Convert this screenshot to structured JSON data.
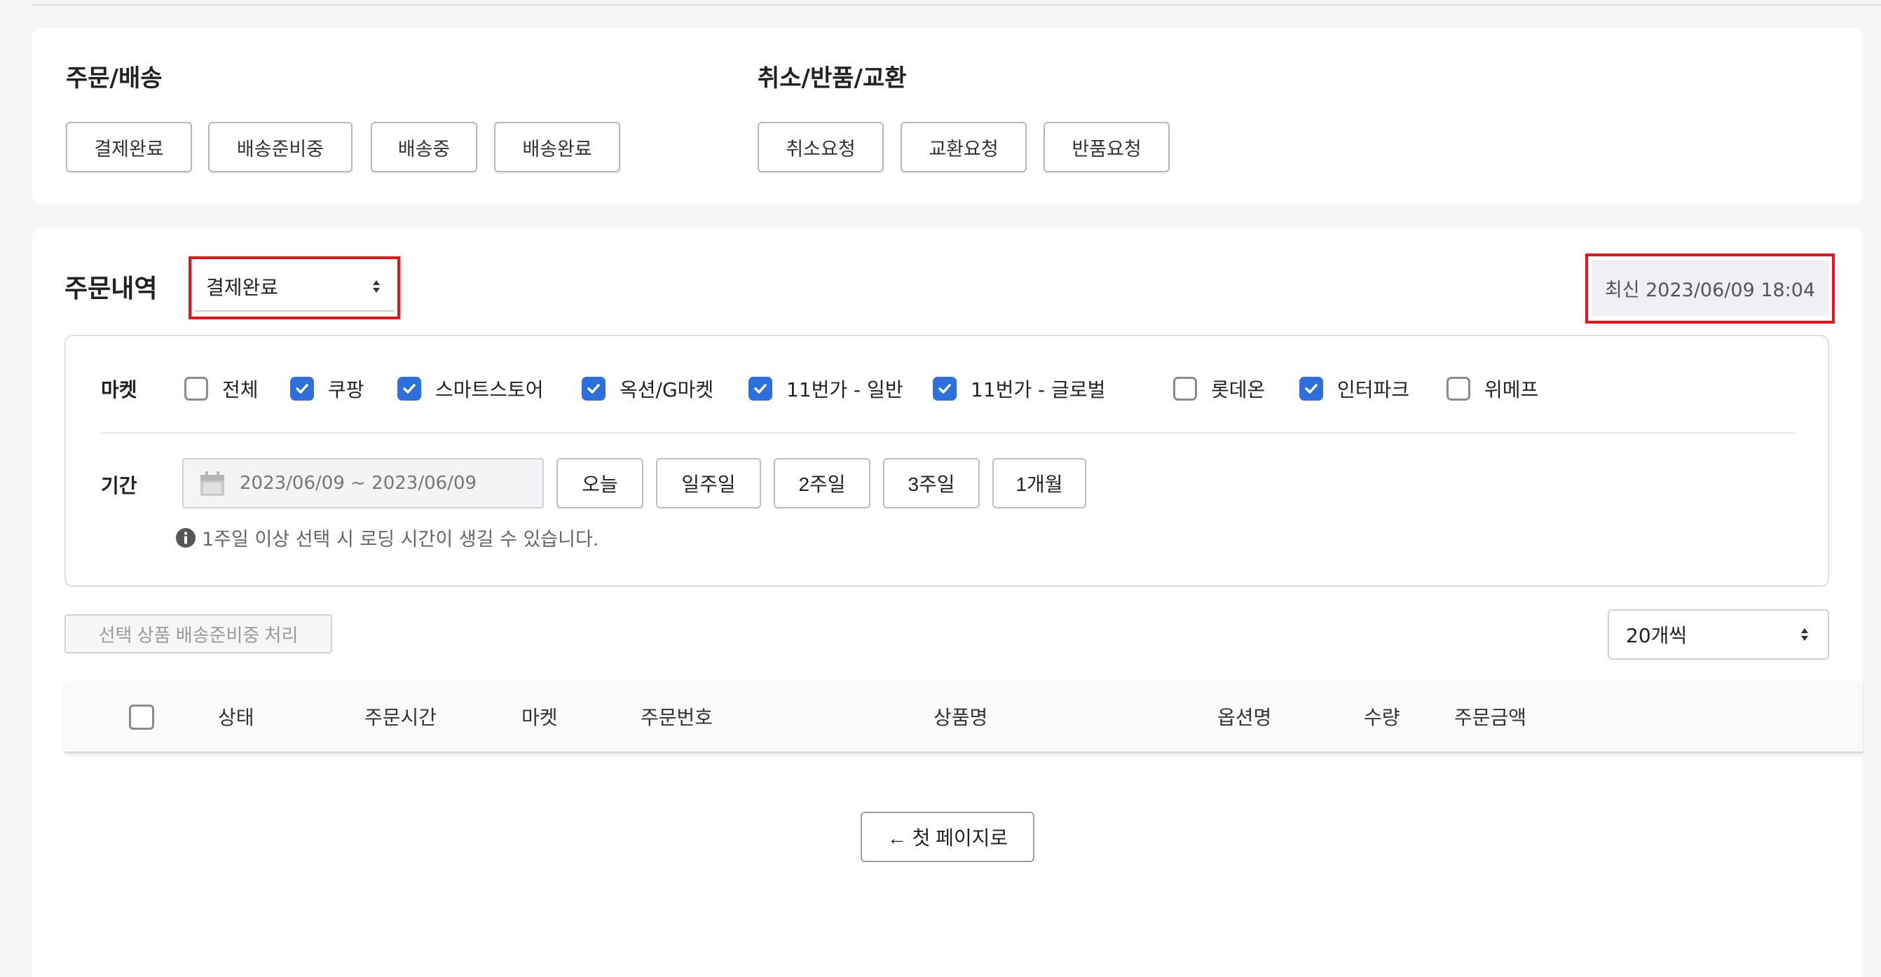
{
  "order_shipping": {
    "title": "주문/배송",
    "buttons": [
      "결제완료",
      "배송준비중",
      "배송중",
      "배송완료"
    ]
  },
  "claims": {
    "title": "취소/반품/교환",
    "buttons": [
      "취소요청",
      "교환요청",
      "반품요청"
    ]
  },
  "order_history": {
    "title": "주문내역",
    "status_select": "결제완료",
    "latest_label": "최신 2023/06/09 18:04"
  },
  "filters": {
    "market_label": "마켓",
    "markets": [
      {
        "label": "전체",
        "checked": false
      },
      {
        "label": "쿠팡",
        "checked": true
      },
      {
        "label": "스마트스토어",
        "checked": true
      },
      {
        "label": "옥션/G마켓",
        "checked": true
      },
      {
        "label": "11번가 - 일반",
        "checked": true
      },
      {
        "label": "11번가 - 글로벌",
        "checked": true
      },
      {
        "label": "롯데온",
        "checked": false
      },
      {
        "label": "인터파크",
        "checked": true
      },
      {
        "label": "위메프",
        "checked": false
      }
    ],
    "period_label": "기간",
    "date_range": "2023/06/09 ~ 2023/06/09",
    "period_buttons": [
      "오늘",
      "일주일",
      "2주일",
      "3주일",
      "1개월"
    ],
    "notice": "1주일 이상 선택 시 로딩 시간이 생길 수 있습니다."
  },
  "actions": {
    "bulk_button": "선택 상품 배송준비중 처리",
    "page_size": "20개씩"
  },
  "table": {
    "columns": [
      "상태",
      "주문시간",
      "마켓",
      "주문번호",
      "상품명",
      "옵션명",
      "수량",
      "주문금액"
    ]
  },
  "pagination": {
    "first_page": "← 첫 페이지로"
  },
  "colors": {
    "highlight": "#e8141c",
    "checkbox_checked": "#2f6fdc"
  }
}
